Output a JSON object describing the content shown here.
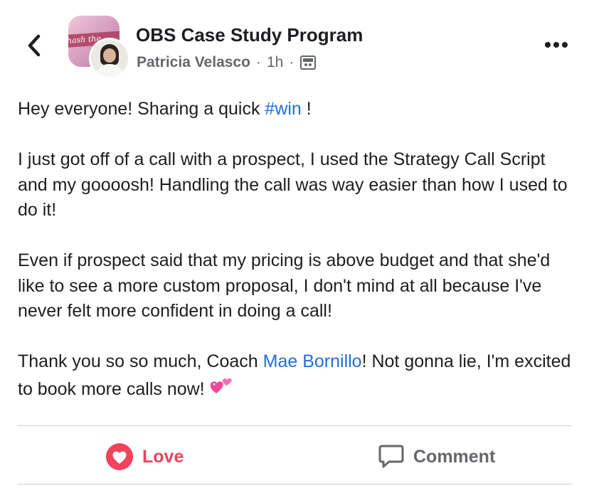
{
  "header": {
    "group_name": "OBS Case Study Program",
    "author": "Patricia Velasco",
    "separator": "·",
    "time": "1h",
    "group_banner_text": "hash the"
  },
  "post": {
    "p1_before": "Hey everyone! Sharing a quick ",
    "p1_hashtag": "#win",
    "p1_after": " !",
    "p2": "I just got off of a call with a prospect, I used the Strategy Call Script and my goooosh! Handling the call was way easier than how I used to do it!",
    "p3": "Even if prospect said that my pricing is above budget and that she'd like to see a more custom proposal, I don't mind at all because I've never felt more confident in doing a call!",
    "p4_before": "Thank you so so much, Coach ",
    "p4_mention": "Mae Bornillo",
    "p4_after": "! Not gonna lie, I'm excited to book more calls now!",
    "p4_emoji": "two-hearts-emoji"
  },
  "actions": {
    "love_label": "Love",
    "comment_label": "Comment"
  },
  "icons": {
    "back": "chevron-left-icon",
    "more": "more-dots-icon",
    "group": "group-icon",
    "love": "love-reaction-icon",
    "comment": "comment-icon"
  },
  "colors": {
    "link": "#216fdb",
    "love": "#e4455e",
    "secondary_text": "#65676b",
    "divider": "#ced0d4"
  }
}
